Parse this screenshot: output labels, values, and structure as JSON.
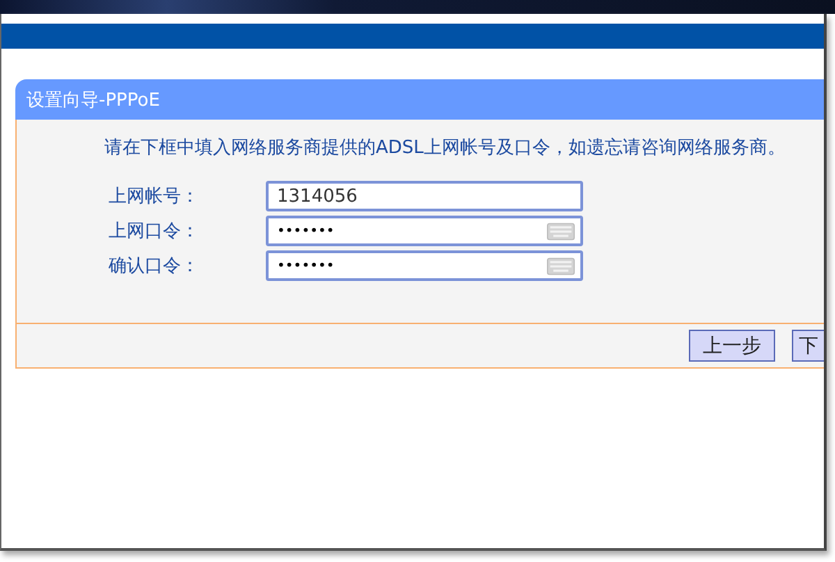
{
  "panel": {
    "title": "设置向导-PPPoE"
  },
  "intro": "请在下框中填入网络服务商提供的ADSL上网帐号及口令，如遗忘请咨询网络服务商。",
  "fields": [
    {
      "label": "上网帐号：",
      "value": "1314056",
      "kind": "text"
    },
    {
      "label": "上网口令：",
      "value": "•••••••",
      "kind": "password"
    },
    {
      "label": "确认口令：",
      "value": "•••••••",
      "kind": "password"
    }
  ],
  "buttons": [
    "上一步",
    "下"
  ]
}
